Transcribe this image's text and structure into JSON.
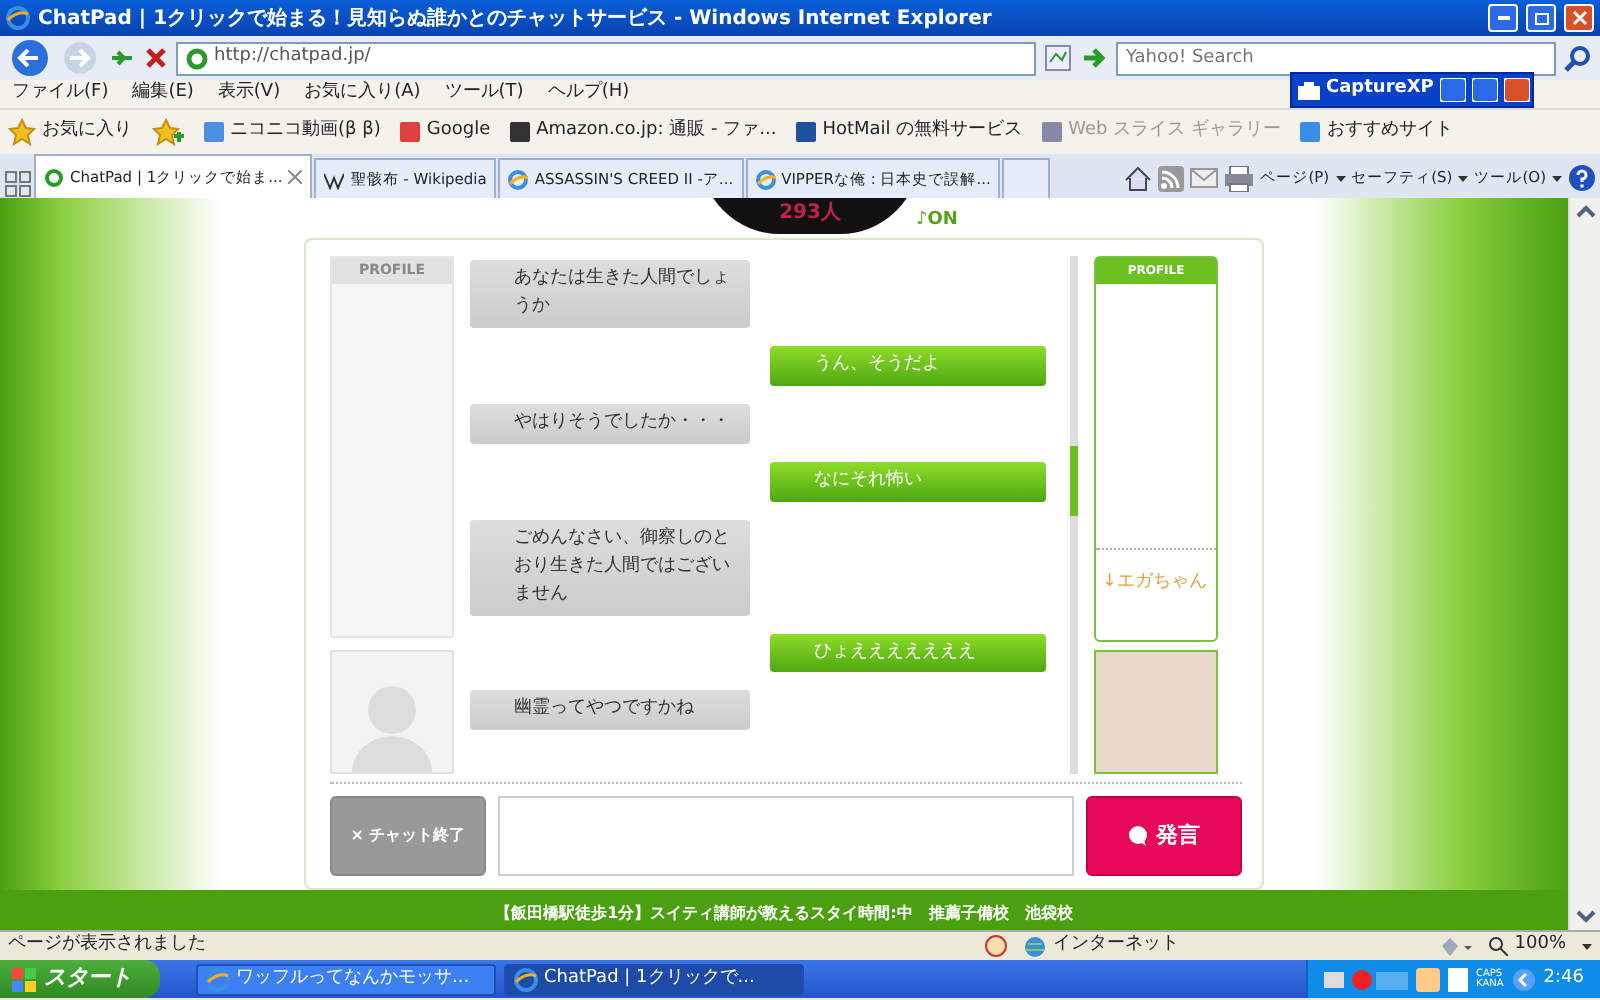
{
  "window": {
    "title": "ChatPad | 1クリックで始まる！見知らぬ誰かとのチャットサービス - Windows Internet Explorer"
  },
  "address_bar": {
    "url": "http://chatpad.jp/",
    "search_placeholder": "Yahoo! Search"
  },
  "menu": [
    "ファイル(F)",
    "編集(E)",
    "表示(V)",
    "お気に入り(A)",
    "ツール(T)",
    "ヘルプ(H)"
  ],
  "favorites_bar": {
    "label": "お気に入り",
    "items": [
      {
        "label": "ニコニコ動画(β β)",
        "dimmed": false
      },
      {
        "label": "Google",
        "dimmed": false
      },
      {
        "label": "Amazon.co.jp: 通販 - ファ...",
        "dimmed": false
      },
      {
        "label": "HotMail の無料サービス",
        "dimmed": false
      },
      {
        "label": "Web スライス ギャラリー",
        "dimmed": true
      },
      {
        "label": "おすすめサイト",
        "dimmed": false
      }
    ]
  },
  "tabs": [
    {
      "label": "ChatPad | 1クリックで始ま...",
      "selected": true
    },
    {
      "label": "聖骸布 - Wikipedia",
      "selected": false
    },
    {
      "label": "ASSASSIN'S CREED II -ア...",
      "selected": false
    },
    {
      "label": "VIPPERな俺 : 日本史で誤解...",
      "selected": false
    }
  ],
  "command_bar": [
    "ページ(P)",
    "セーフティ(S)",
    "ツール(O)"
  ],
  "overlay_window": {
    "title": "CaptureXP"
  },
  "page": {
    "user_count": "293人",
    "sound": "♪ON",
    "left_profile": {
      "header": "PROFILE"
    },
    "right_profile": {
      "header": "PROFILE",
      "comment": "↓エガちゃん"
    },
    "messages": [
      {
        "kind": "incoming",
        "text": "あなたは生きた人間でしょうか"
      },
      {
        "kind": "outgoing",
        "text": "うん、そうだよ"
      },
      {
        "kind": "incoming",
        "text": "やはりそうでしたか・・・"
      },
      {
        "kind": "outgoing",
        "text": "なにそれ怖い"
      },
      {
        "kind": "incoming",
        "text": "ごめんなさい、御察しのとおり生きた人間ではございません"
      },
      {
        "kind": "outgoing",
        "text": "ひょえええええええ"
      },
      {
        "kind": "incoming",
        "text": "幽霊ってやつですかね"
      }
    ],
    "end_button": "× チャット終了",
    "send_button": "発言",
    "footer_link": "【飯田橋駅徒歩1分】スイティ講師が教えるスタイ時間:中　推薦子備校　池袋校"
  },
  "status_bar": {
    "text": "ページが表示されました",
    "zone": "インターネット",
    "zoom": "100%"
  },
  "taskbar": {
    "start": "スタート",
    "tasks": [
      {
        "label": "ワッフルってなんかモッサ...",
        "selected": false
      },
      {
        "label": "ChatPad | 1クリックで...",
        "selected": true
      }
    ],
    "tray_text": [
      "CAPS",
      "KANA"
    ],
    "time": "2:46"
  }
}
